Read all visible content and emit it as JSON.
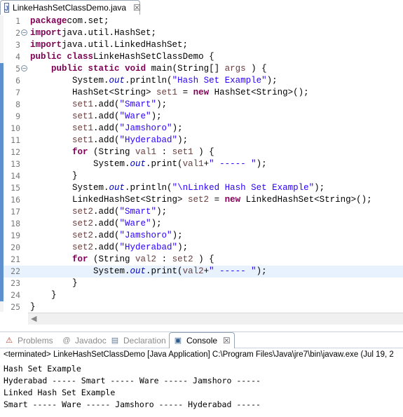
{
  "editor_tab": {
    "label": "LinkeHashSetClassDemo.java",
    "close": "☒"
  },
  "code_lines": [
    [
      [
        "k",
        "package"
      ],
      [
        "",
        "com.set;"
      ]
    ],
    [
      [
        "k",
        "import"
      ],
      [
        "",
        "java.util.HashSet;"
      ]
    ],
    [
      [
        "k",
        "import"
      ],
      [
        "",
        "java.util.LinkedHashSet;"
      ]
    ],
    [
      [
        "k",
        "public"
      ],
      [
        "",
        " "
      ],
      [
        "k",
        "class"
      ],
      [
        "",
        "",
        " "
      ],
      [
        "",
        "LinkeHashSetClassDemo {"
      ]
    ],
    [
      [
        "",
        " "
      ],
      [
        "k",
        "public"
      ],
      [
        "",
        " "
      ],
      [
        "k",
        "static"
      ],
      [
        "",
        " "
      ],
      [
        "k",
        "void"
      ],
      [
        "",
        " main(String[] "
      ],
      [
        "v",
        "args"
      ],
      [
        "",
        " ) {"
      ]
    ],
    [
      [
        "",
        " System."
      ],
      [
        "f",
        "out"
      ],
      [
        "",
        ".println("
      ],
      [
        "s",
        "\"Hash Set Example\""
      ],
      [
        "",
        ");"
      ]
    ],
    [
      [
        "",
        " HashSet<String> "
      ],
      [
        "v",
        "set1"
      ],
      [
        "",
        " = "
      ],
      [
        "k",
        "new"
      ],
      [
        "",
        " HashSet<String>();"
      ]
    ],
    [
      [
        "",
        " "
      ],
      [
        "v",
        "set1"
      ],
      [
        "",
        ".add("
      ],
      [
        "s",
        "\"Smart\""
      ],
      [
        "",
        ");"
      ]
    ],
    [
      [
        "",
        " "
      ],
      [
        "v",
        "set1"
      ],
      [
        "",
        ".add("
      ],
      [
        "s",
        "\"Ware\""
      ],
      [
        "",
        ");"
      ]
    ],
    [
      [
        "",
        " "
      ],
      [
        "v",
        "set1"
      ],
      [
        "",
        ".add("
      ],
      [
        "s",
        "\"Jamshoro\""
      ],
      [
        "",
        ");"
      ]
    ],
    [
      [
        "",
        " "
      ],
      [
        "v",
        "set1"
      ],
      [
        "",
        ".add("
      ],
      [
        "s",
        "\"Hyderabad\""
      ],
      [
        "",
        ");"
      ]
    ],
    [
      [
        "",
        " "
      ],
      [
        "k",
        "for"
      ],
      [
        "",
        " (String "
      ],
      [
        "v",
        "val1"
      ],
      [
        "",
        " : "
      ],
      [
        "v",
        "set1"
      ],
      [
        "",
        " ) {"
      ]
    ],
    [
      [
        "",
        " System."
      ],
      [
        "f",
        "out"
      ],
      [
        "",
        ".print("
      ],
      [
        "v",
        "val1"
      ],
      [
        "",
        "+"
      ],
      [
        "s",
        "\" ----- \""
      ],
      [
        "",
        ");"
      ]
    ],
    [
      [
        "",
        " }"
      ]
    ],
    [
      [
        "",
        " System."
      ],
      [
        "f",
        "out"
      ],
      [
        "",
        ".println("
      ],
      [
        "s",
        "\"\\nLinked Hash Set Example\""
      ],
      [
        "",
        ");"
      ]
    ],
    [
      [
        "",
        " LinkedHashSet<String> "
      ],
      [
        "v",
        "set2"
      ],
      [
        "",
        " = "
      ],
      [
        "k",
        "new"
      ],
      [
        "",
        " LinkedHashSet<String>();"
      ]
    ],
    [
      [
        "",
        " "
      ],
      [
        "v",
        "set2"
      ],
      [
        "",
        ".add("
      ],
      [
        "s",
        "\"Smart\""
      ],
      [
        "",
        ");"
      ]
    ],
    [
      [
        "",
        " "
      ],
      [
        "v",
        "set2"
      ],
      [
        "",
        ".add("
      ],
      [
        "s",
        "\"Ware\""
      ],
      [
        "",
        ");"
      ]
    ],
    [
      [
        "",
        " "
      ],
      [
        "v",
        "set2"
      ],
      [
        "",
        ".add("
      ],
      [
        "s",
        "\"Jamshoro\""
      ],
      [
        "",
        ");"
      ]
    ],
    [
      [
        "",
        " "
      ],
      [
        "v",
        "set2"
      ],
      [
        "",
        ".add("
      ],
      [
        "s",
        "\"Hyderabad\""
      ],
      [
        "",
        ");"
      ]
    ],
    [
      [
        "",
        " "
      ],
      [
        "k",
        "for"
      ],
      [
        "",
        " (String "
      ],
      [
        "v",
        "val2"
      ],
      [
        "",
        " : "
      ],
      [
        "v",
        "set2"
      ],
      [
        "",
        " ) {"
      ]
    ],
    [
      [
        "",
        " System."
      ],
      [
        "f",
        "out"
      ],
      [
        "",
        ".print("
      ],
      [
        "v",
        "val2"
      ],
      [
        "",
        "+"
      ],
      [
        "s",
        "\" ----- \""
      ],
      [
        "",
        ");"
      ]
    ],
    [
      [
        "",
        " }"
      ]
    ],
    [
      [
        "",
        " }"
      ]
    ],
    [
      [
        "",
        "}"
      ]
    ]
  ],
  "views": {
    "problems": "Problems",
    "javadoc": "Javadoc",
    "declaration": "Declaration",
    "console": "Console",
    "close": "☒"
  },
  "console": {
    "header": "<terminated> LinkeHashSetClassDemo [Java Application] C:\\Program Files\\Java\\jre7\\bin\\javaw.exe (Jul 19, 2",
    "output": [
      "Hash Set Example",
      "Hyderabad ----- Smart ----- Ware ----- Jamshoro -----",
      "Linked Hash Set Example",
      "Smart ----- Ware ----- Jamshoro ----- Hyderabad -----"
    ]
  }
}
